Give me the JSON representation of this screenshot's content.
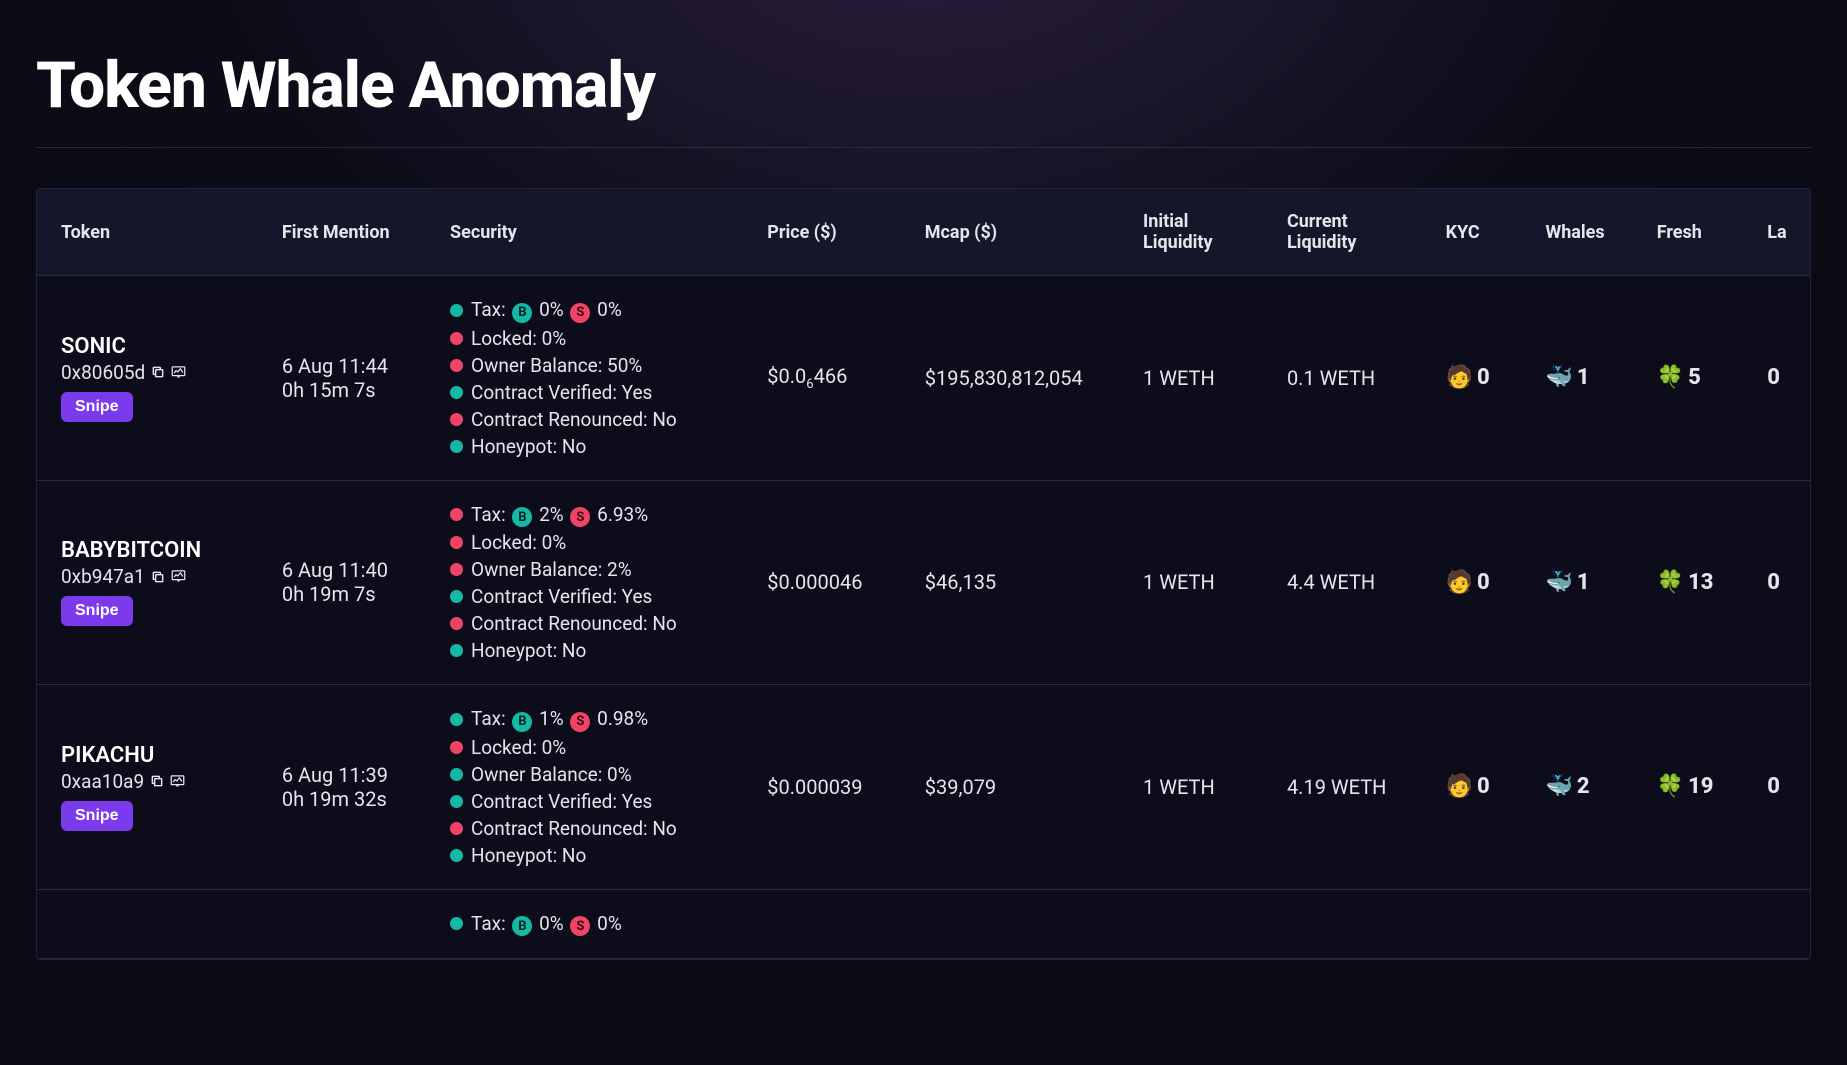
{
  "title": "Token Whale Anomaly",
  "columns": [
    "Token",
    "First Mention",
    "Security",
    "Price ($)",
    "Mcap ($)",
    "Initial Liquidity",
    "Current Liquidity",
    "KYC",
    "Whales",
    "Fresh",
    "La"
  ],
  "snipe_label": "Snipe",
  "sec_labels": {
    "tax": "Tax:",
    "locked": "Locked:",
    "owner": "Owner Balance:",
    "verified": "Contract Verified:",
    "renounced": "Contract Renounced:",
    "honeypot": "Honeypot:"
  },
  "badge": {
    "b": "B",
    "s": "S"
  },
  "emoji": {
    "kyc": "🧑",
    "whale": "🐳",
    "fresh": "🍀"
  },
  "rows": [
    {
      "name": "SONIC",
      "addr": "0x80605d",
      "fm_date": "6 Aug 11:44",
      "fm_rel": "0h 15m 7s",
      "sec": {
        "tax_color": "g",
        "tax_b": "0%",
        "tax_s": "0%",
        "locked_color": "r",
        "locked": "0%",
        "owner_color": "r",
        "owner": "50%",
        "verified_color": "g",
        "verified": "Yes",
        "renounced_color": "r",
        "renounced": "No",
        "honeypot_color": "g",
        "honeypot": "No"
      },
      "price_pre": "$0.0",
      "price_sub": "6",
      "price_post": "466",
      "mcap": "$195,830,812,054",
      "iliq": "1 WETH",
      "cliq": "0.1 WETH",
      "kyc": "0",
      "whales": "1",
      "fresh": "5",
      "la": "0"
    },
    {
      "name": "BABYBITCOIN",
      "addr": "0xb947a1",
      "fm_date": "6 Aug 11:40",
      "fm_rel": "0h 19m 7s",
      "sec": {
        "tax_color": "r",
        "tax_b": "2%",
        "tax_s": "6.93%",
        "locked_color": "r",
        "locked": "0%",
        "owner_color": "r",
        "owner": "2%",
        "verified_color": "g",
        "verified": "Yes",
        "renounced_color": "r",
        "renounced": "No",
        "honeypot_color": "g",
        "honeypot": "No"
      },
      "price_pre": "$0.000046",
      "price_sub": "",
      "price_post": "",
      "mcap": "$46,135",
      "iliq": "1 WETH",
      "cliq": "4.4 WETH",
      "kyc": "0",
      "whales": "1",
      "fresh": "13",
      "la": "0"
    },
    {
      "name": "PIKACHU",
      "addr": "0xaa10a9",
      "fm_date": "6 Aug 11:39",
      "fm_rel": "0h 19m 32s",
      "sec": {
        "tax_color": "g",
        "tax_b": "1%",
        "tax_s": "0.98%",
        "locked_color": "r",
        "locked": "0%",
        "owner_color": "g",
        "owner": "0%",
        "verified_color": "g",
        "verified": "Yes",
        "renounced_color": "r",
        "renounced": "No",
        "honeypot_color": "g",
        "honeypot": "No"
      },
      "price_pre": "$0.000039",
      "price_sub": "",
      "price_post": "",
      "mcap": "$39,079",
      "iliq": "1 WETH",
      "cliq": "4.19 WETH",
      "kyc": "0",
      "whales": "2",
      "fresh": "19",
      "la": "0"
    },
    {
      "name": "",
      "addr": "",
      "fm_date": "",
      "fm_rel": "",
      "sec": {
        "tax_color": "g",
        "tax_b": "0%",
        "tax_s": "0%",
        "locked_color": "",
        "locked": "",
        "owner_color": "",
        "owner": "",
        "verified_color": "",
        "verified": "",
        "renounced_color": "",
        "renounced": "",
        "honeypot_color": "",
        "honeypot": ""
      },
      "price_pre": "",
      "price_sub": "",
      "price_post": "",
      "mcap": "",
      "iliq": "",
      "cliq": "",
      "kyc": "",
      "whales": "",
      "fresh": "",
      "la": ""
    }
  ]
}
